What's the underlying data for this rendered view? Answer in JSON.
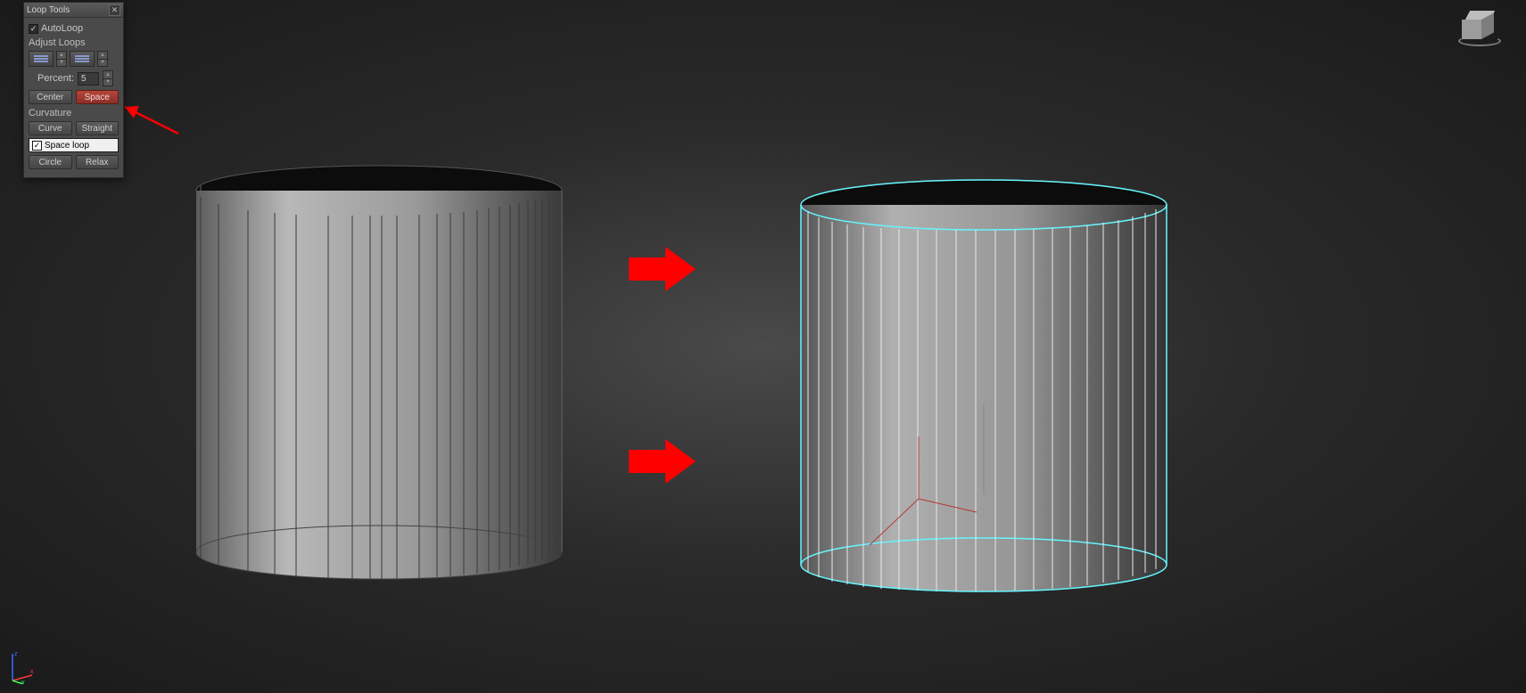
{
  "panel": {
    "title": "Loop Tools",
    "autoloop_label": "AutoLoop",
    "autoloop_checked": true,
    "adjust_loops_label": "Adjust Loops",
    "percent_label": "Percent:",
    "percent_value": "5",
    "center_label": "Center",
    "space_label": "Space",
    "curvature_label": "Curvature",
    "curve_label": "Curve",
    "straight_label": "Straight",
    "space_loop_label": "Space loop",
    "space_loop_checked": true,
    "circle_label": "Circle",
    "relax_label": "Relax"
  },
  "viewcube": {
    "name": "ViewCube"
  },
  "axis": {
    "x": "x",
    "y": "y",
    "z": "z"
  }
}
